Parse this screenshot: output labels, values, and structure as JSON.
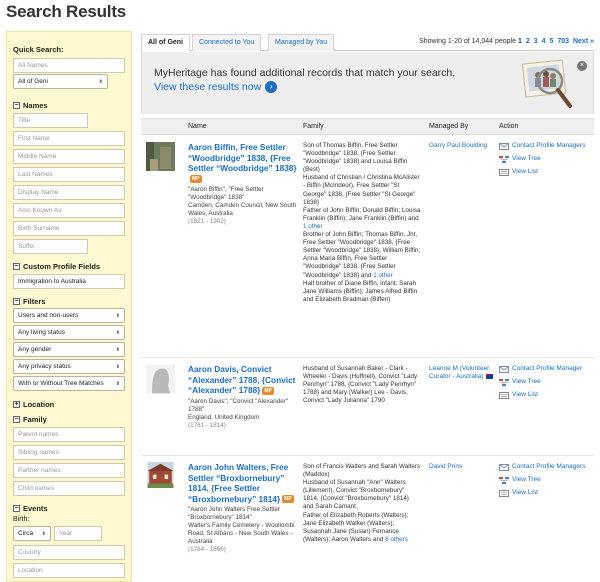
{
  "page_title": "Search Results",
  "sidebar": {
    "quick_search": {
      "label": "Quick Search:",
      "input_placeholder": "All Names",
      "select_value": "All of Geni"
    },
    "names": {
      "label": "Names",
      "fields": [
        "Title",
        "First Name",
        "Middle Name",
        "Last Names",
        "Display Name",
        "Also Known As",
        "Birth Surname",
        "Suffix"
      ]
    },
    "custom_fields": {
      "label": "Custom Profile Fields",
      "value": "Immigration to Australia"
    },
    "filters": {
      "label": "Filters",
      "selects": [
        "Users and non-users",
        "Any living status",
        "Any gender",
        "Any privacy status",
        "With or Without Tree Matches"
      ]
    },
    "location": {
      "label": "Location"
    },
    "family": {
      "label": "Family",
      "fields": [
        "Parent names",
        "Sibling names",
        "Partner names",
        "Child names"
      ]
    },
    "events": {
      "label": "Events",
      "birth_label": "Birth:",
      "circa_value": "Circa",
      "year_placeholder": "Year",
      "country_placeholder": "Country",
      "location_placeholder": "Location"
    }
  },
  "tabs": [
    {
      "label": "All of Geni",
      "active": true
    },
    {
      "label": "Connected to You",
      "active": false
    },
    {
      "label": "Managed by You",
      "active": false
    }
  ],
  "showing_text": "Showing 1-20 of 14,044 people",
  "pager": {
    "current": "1",
    "pages": [
      "2",
      "3",
      "4",
      "5",
      "703"
    ],
    "next": "Next »"
  },
  "banner": {
    "line1": "MyHeritage has found additional records that match your search.",
    "link": "View these results now",
    "close": "×"
  },
  "table": {
    "headers": [
      "Name",
      "Family",
      "Managed By",
      "Action"
    ],
    "rows": [
      {
        "name": "Aaron Biffin, Free Settler “Woodbridge” 1838, {Free Settler “Woodbridge” 1838}",
        "badge": "MP",
        "aka": "\"Aaron Biffin\", \"Free Settler \"Woodbridge\" 1838\"",
        "place": "Camden, Camden Council, New South Wales, Australia",
        "dates": "(1821 - 1902)",
        "family": "Son of Thomas Biffin, Free Settler \"Woodbridge\" 1838, {Free Settler \"Woodbridge\" 1838} and Louisa Biffin (Best)\nHusband of Christian / Christina McAlister - Biffin (McIndeor), Free Settler \"St George\" 1838, {Free Settler \"St George\" 1838}\nFather of John Biffin; Donald Biffin; Louisa Franklin (Biffin); Jane Franklin (Biffin) and",
        "family_more_1": "1 other",
        "family_2": "Brother of John Biffin; Thomas Biffin, Jnr, Free Settler \"Woodbridge\" 1838, {Free Settler \"Woodbridge\" 1838}; William Biffin; Anna Maria Biffin, Free Settler \"Woodbridge\" 1838, {Free Settler \"Woodbridge\" 1838} and",
        "family_more_2": "1 other",
        "family_3": "Half brother of Diane Biffin, infant; Sarah Jane Williams (Biffin); James Alfred Biffin and Elizabeth Bradman (Biffen)",
        "manager": "Garry Paul Boulding",
        "actions": [
          "Contact Profile Managers",
          "View Tree",
          "View List"
        ]
      },
      {
        "name": "Aaron Davis, Convict “Alexander” 1788, {Convict “Alexander” 1788}",
        "badge": "MP",
        "aka": "\"Aaron Davis\", \"Convict \"Alexander\" 1788\"",
        "place": "England, United Kingdom",
        "dates": "(1761 - 1814)",
        "family": "Husband of Susannah Baker - Clark - Wheeler - Davis (Huffnell), Convict \"Lady Penrhyn\" 1788, {Convict \"Lady Penrhyn\" 1788} and Mary (Walker) Lee - Davis, Convict \"Lady Julianna\" 1790",
        "manager": "Leanne M (Volunteer Curator - Australia)",
        "actions": [
          "Contact Profile Manager",
          "View Tree",
          "View List"
        ]
      },
      {
        "name": "Aaron John Walters, Free Settler “Broxbornebury” 1814, {Free Settler “Broxbornebury” 1814}",
        "badge": "MP",
        "aka": "\"Aaron John Walters Free Settler \"Broxbornebury\" 1814\"",
        "place": "Walter's Family Cemetery - Woollombi Road, St Albans - New South Wales - Australia",
        "dates": "(1784 - 1866)",
        "family": "Son of Francis Walters and Sarah Walters (Maddox)\nHusband of Susannah \"Ann\" Walters (Lillement), Convict \"Broxbornebury\" 1814, {Convict \"Broxbornebury\" 1814} and Sarah Camant\nFather of Elizabeth Roberts (Walters); Jane Elizabeth Walker (Walters); Susannah Jane (Susan) Fernance (Walters); Aaron Walters and",
        "family_more_1": "6 others",
        "manager": "David Prins",
        "actions": [
          "Contact Profile Managers",
          "View Tree",
          "View List"
        ]
      }
    ]
  },
  "colors": {
    "link": "#1a6fc4",
    "sidebar_bg": "#fdf8cf",
    "badge": "#e38b31"
  }
}
